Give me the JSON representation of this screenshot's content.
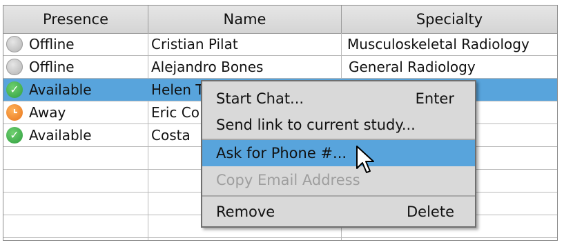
{
  "columns": [
    "Presence",
    "Name",
    "Specialty"
  ],
  "rows": [
    {
      "presence": "Offline",
      "status": "offline",
      "name": "Cristian Pilat",
      "specialty": "Musculoskeletal Radiology"
    },
    {
      "presence": "Offline",
      "status": "offline",
      "name": "Alejandro Bones",
      "specialty": "General Radiology"
    },
    {
      "presence": "Available",
      "status": "available",
      "name": "Helen T",
      "specialty": "",
      "selected": true
    },
    {
      "presence": "Away",
      "status": "away",
      "name": "Eric Co",
      "specialty": ""
    },
    {
      "presence": "Available",
      "status": "available",
      "name": "Costa",
      "specialty": ""
    }
  ],
  "context_menu": {
    "items": [
      {
        "label": "Start Chat...",
        "accelerator": "Enter"
      },
      {
        "label": "Send link to current study...",
        "accelerator": ""
      },
      {
        "label": "Ask for Phone #...",
        "accelerator": "",
        "hovered": true
      },
      {
        "label": "Copy Email Address",
        "accelerator": "",
        "disabled": true
      },
      {
        "label": "Remove",
        "accelerator": "Delete"
      }
    ]
  },
  "colors": {
    "selection": "#58a4dc",
    "available": "#2f9e3f",
    "away": "#e8751b",
    "offline": "#b4b4b4"
  },
  "icons": {
    "available": "check-mark",
    "away": "clock-hand",
    "offline": "empty-circle",
    "cursor": "arrow-pointer"
  }
}
